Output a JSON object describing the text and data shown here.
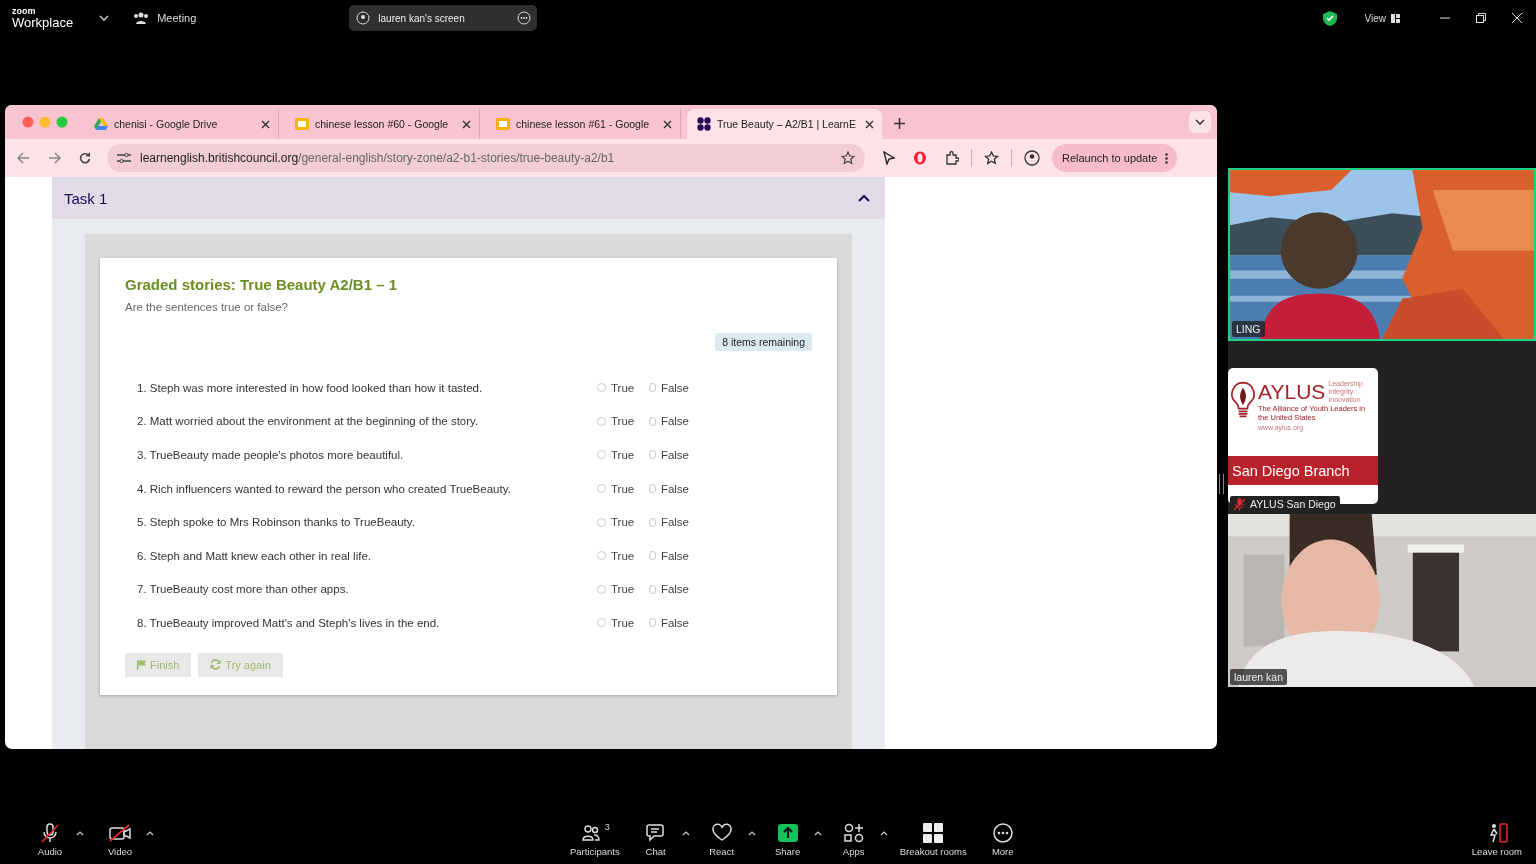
{
  "zoom_bar": {
    "logo_small": "zoom",
    "logo": "Workplace",
    "meeting_label": "Meeting",
    "share_pill": "lauren kan's screen",
    "view_label": "View"
  },
  "browser": {
    "tabs": [
      {
        "title": "chenisi - Google Drive",
        "selected": false
      },
      {
        "title": "chinese lesson #60 - Google",
        "selected": false
      },
      {
        "title": "chinese lesson #61 - Google",
        "selected": false
      },
      {
        "title": "True Beauty – A2/B1 | LearnE",
        "selected": true
      }
    ],
    "url_domain": "learnenglish.britishcouncil.org",
    "url_path": "/general-english/story-zone/a2-b1-stories/true-beauty-a2/b1",
    "relaunch": "Relaunch to update"
  },
  "page": {
    "task_title": "Task 1",
    "expanded": true,
    "quiz_title": "Graded stories: True Beauty A2/B1 – 1",
    "instruction": "Are the sentences true or false?",
    "remaining": "8 items remaining",
    "questions": [
      {
        "text": "1. Steph was more interested in how food looked than how it tasted.",
        "options": [
          {
            "label": "True",
            "selected": false
          },
          {
            "label": "False",
            "selected": false
          }
        ]
      },
      {
        "text": "2. Matt worried about the environment at the beginning of the story.",
        "options": [
          {
            "label": "True",
            "selected": false
          },
          {
            "label": "False",
            "selected": false
          }
        ]
      },
      {
        "text": "3. TrueBeauty made people's photos more beautiful.",
        "options": [
          {
            "label": "True",
            "selected": false
          },
          {
            "label": "False",
            "selected": false
          }
        ]
      },
      {
        "text": "4. Rich influencers wanted to reward the person who created TrueBeauty.",
        "options": [
          {
            "label": "True",
            "selected": false
          },
          {
            "label": "False",
            "selected": false
          }
        ]
      },
      {
        "text": "5. Steph spoke to Mrs Robinson thanks to TrueBeauty.",
        "options": [
          {
            "label": "True",
            "selected": false
          },
          {
            "label": "False",
            "selected": false
          }
        ]
      },
      {
        "text": "6. Steph and Matt knew each other in real life.",
        "options": [
          {
            "label": "True",
            "selected": false
          },
          {
            "label": "False",
            "selected": false
          }
        ]
      },
      {
        "text": "7. TrueBeauty cost more than other apps.",
        "options": [
          {
            "label": "True",
            "selected": false
          },
          {
            "label": "False",
            "selected": false
          }
        ]
      },
      {
        "text": "8. TrueBeauty improved Matt's and Steph's lives in the end.",
        "options": [
          {
            "label": "True",
            "selected": false
          },
          {
            "label": "False",
            "selected": false
          }
        ]
      }
    ],
    "buttons": [
      {
        "label": "Finish",
        "disabled": true
      },
      {
        "label": "Try again",
        "disabled": true
      }
    ]
  },
  "participants": [
    {
      "name": "LING",
      "kind": "video",
      "speaking": true,
      "muted": false
    },
    {
      "name": "AYLUS San Diego",
      "kind": "logo",
      "speaking": false,
      "muted": true,
      "logo": {
        "brand": "AYLUS",
        "motto": [
          "Leadership",
          "Integrity",
          "Innovation"
        ],
        "tagline": "The Alliance of Youth Leaders in the United States",
        "site": "www.aylus.org",
        "branch": "San Diego Branch"
      }
    },
    {
      "name": "lauren kan",
      "kind": "video",
      "speaking": false,
      "muted": false
    }
  ],
  "toolbar": {
    "left": [
      {
        "label": "Audio",
        "off": true,
        "caret": true
      },
      {
        "label": "Video",
        "off": true,
        "caret": true
      }
    ],
    "center": [
      {
        "label": "Participants",
        "count": "3",
        "caret": false
      },
      {
        "label": "Chat",
        "caret": true
      },
      {
        "label": "React",
        "caret": true
      },
      {
        "label": "Share",
        "caret": true
      },
      {
        "label": "Apps",
        "caret": true
      },
      {
        "label": "Breakout rooms",
        "caret": false
      },
      {
        "label": "More",
        "caret": false
      }
    ],
    "right": [
      {
        "label": "Leave room",
        "caret": false
      }
    ]
  }
}
